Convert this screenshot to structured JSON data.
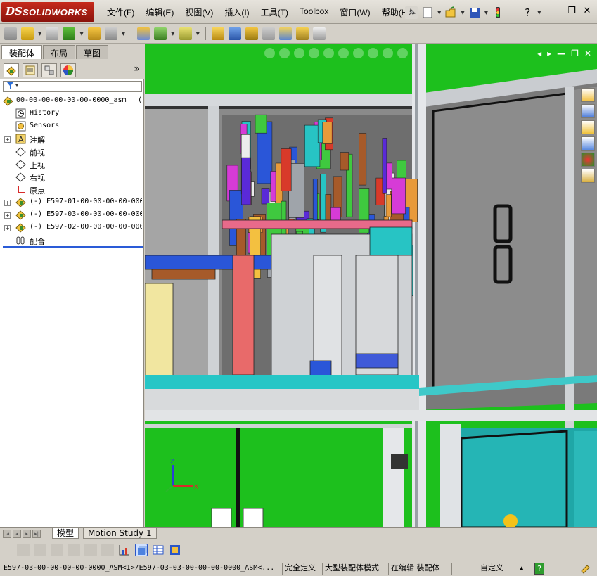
{
  "app": {
    "logo_prefix": "DS",
    "logo_text": "SOLIDWORKS"
  },
  "menu": [
    "文件(F)",
    "编辑(E)",
    "视图(V)",
    "插入(I)",
    "工具(T)",
    "Toolbox",
    "窗口(W)",
    "帮助(H)"
  ],
  "title_tools": {
    "help_glyph": "?"
  },
  "window_buttons": {
    "minimize": "—",
    "restore": "❐",
    "close": "✕"
  },
  "panel_tabs": [
    "装配体",
    "布局",
    "草图"
  ],
  "panel_more_glyph": "»",
  "tree": {
    "root": "00-00-00-00-00-00-0000_asm",
    "root_suffix": "(D",
    "items": [
      {
        "label": "History",
        "icon": "history-icon",
        "mono": true
      },
      {
        "label": "Sensors",
        "icon": "sensors-icon",
        "mono": true
      },
      {
        "label": "注解",
        "icon": "annotations-icon",
        "expand": "+"
      },
      {
        "label": "前视",
        "icon": "plane-icon"
      },
      {
        "label": "上视",
        "icon": "plane-icon"
      },
      {
        "label": "右视",
        "icon": "plane-icon"
      },
      {
        "label": "原点",
        "icon": "origin-icon"
      },
      {
        "label": "(-) E597-01-00-00-00-00-000",
        "icon": "subassembly-icon",
        "expand": "+",
        "mono": true
      },
      {
        "label": "(-) E597-03-00-00-00-00-000",
        "icon": "subassembly-icon",
        "expand": "+",
        "mono": true
      },
      {
        "label": "(-) E597-02-00-00-00-00-000",
        "icon": "subassembly-icon",
        "expand": "+",
        "mono": true
      },
      {
        "label": "配合",
        "icon": "mates-icon"
      }
    ]
  },
  "bottom_tabs": [
    "模型",
    "Motion Study 1"
  ],
  "triad": {
    "z": "Z",
    "x": "X"
  },
  "status": {
    "path": "E597-03-00-00-00-00-0000_ASM<1>/E597-03-03-00-00-00-0000_ASM<...",
    "state": "完全定义",
    "mode": "大型装配体模式",
    "editing": "在编辑 装配体",
    "units": "自定义",
    "units_arrow": "▴",
    "help": "?"
  }
}
